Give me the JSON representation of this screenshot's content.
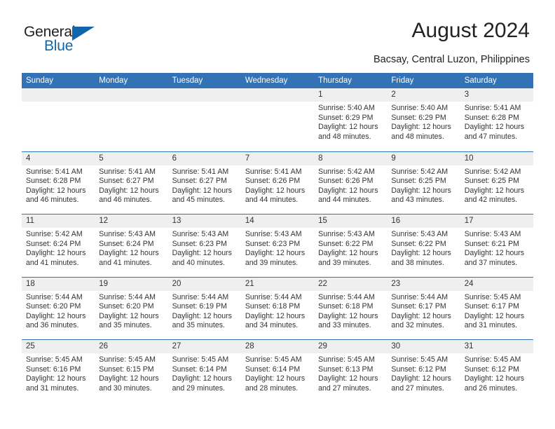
{
  "brand": {
    "name_part1": "General",
    "name_part2": "Blue",
    "accent_color": "#1166ab"
  },
  "header": {
    "title": "August 2024",
    "location": "Bacsay, Central Luzon, Philippines"
  },
  "theme": {
    "header_bg": "#3272b5",
    "daynum_bg": "#efefef",
    "text_color": "#333333"
  },
  "weekday_headers": [
    "Sunday",
    "Monday",
    "Tuesday",
    "Wednesday",
    "Thursday",
    "Friday",
    "Saturday"
  ],
  "weeks": [
    [
      {
        "day": "",
        "sunrise": "",
        "sunset": "",
        "daylight1": "",
        "daylight2": ""
      },
      {
        "day": "",
        "sunrise": "",
        "sunset": "",
        "daylight1": "",
        "daylight2": ""
      },
      {
        "day": "",
        "sunrise": "",
        "sunset": "",
        "daylight1": "",
        "daylight2": ""
      },
      {
        "day": "",
        "sunrise": "",
        "sunset": "",
        "daylight1": "",
        "daylight2": ""
      },
      {
        "day": "1",
        "sunrise": "Sunrise: 5:40 AM",
        "sunset": "Sunset: 6:29 PM",
        "daylight1": "Daylight: 12 hours",
        "daylight2": "and 48 minutes."
      },
      {
        "day": "2",
        "sunrise": "Sunrise: 5:40 AM",
        "sunset": "Sunset: 6:29 PM",
        "daylight1": "Daylight: 12 hours",
        "daylight2": "and 48 minutes."
      },
      {
        "day": "3",
        "sunrise": "Sunrise: 5:41 AM",
        "sunset": "Sunset: 6:28 PM",
        "daylight1": "Daylight: 12 hours",
        "daylight2": "and 47 minutes."
      }
    ],
    [
      {
        "day": "4",
        "sunrise": "Sunrise: 5:41 AM",
        "sunset": "Sunset: 6:28 PM",
        "daylight1": "Daylight: 12 hours",
        "daylight2": "and 46 minutes."
      },
      {
        "day": "5",
        "sunrise": "Sunrise: 5:41 AM",
        "sunset": "Sunset: 6:27 PM",
        "daylight1": "Daylight: 12 hours",
        "daylight2": "and 46 minutes."
      },
      {
        "day": "6",
        "sunrise": "Sunrise: 5:41 AM",
        "sunset": "Sunset: 6:27 PM",
        "daylight1": "Daylight: 12 hours",
        "daylight2": "and 45 minutes."
      },
      {
        "day": "7",
        "sunrise": "Sunrise: 5:41 AM",
        "sunset": "Sunset: 6:26 PM",
        "daylight1": "Daylight: 12 hours",
        "daylight2": "and 44 minutes."
      },
      {
        "day": "8",
        "sunrise": "Sunrise: 5:42 AM",
        "sunset": "Sunset: 6:26 PM",
        "daylight1": "Daylight: 12 hours",
        "daylight2": "and 44 minutes."
      },
      {
        "day": "9",
        "sunrise": "Sunrise: 5:42 AM",
        "sunset": "Sunset: 6:25 PM",
        "daylight1": "Daylight: 12 hours",
        "daylight2": "and 43 minutes."
      },
      {
        "day": "10",
        "sunrise": "Sunrise: 5:42 AM",
        "sunset": "Sunset: 6:25 PM",
        "daylight1": "Daylight: 12 hours",
        "daylight2": "and 42 minutes."
      }
    ],
    [
      {
        "day": "11",
        "sunrise": "Sunrise: 5:42 AM",
        "sunset": "Sunset: 6:24 PM",
        "daylight1": "Daylight: 12 hours",
        "daylight2": "and 41 minutes."
      },
      {
        "day": "12",
        "sunrise": "Sunrise: 5:43 AM",
        "sunset": "Sunset: 6:24 PM",
        "daylight1": "Daylight: 12 hours",
        "daylight2": "and 41 minutes."
      },
      {
        "day": "13",
        "sunrise": "Sunrise: 5:43 AM",
        "sunset": "Sunset: 6:23 PM",
        "daylight1": "Daylight: 12 hours",
        "daylight2": "and 40 minutes."
      },
      {
        "day": "14",
        "sunrise": "Sunrise: 5:43 AM",
        "sunset": "Sunset: 6:23 PM",
        "daylight1": "Daylight: 12 hours",
        "daylight2": "and 39 minutes."
      },
      {
        "day": "15",
        "sunrise": "Sunrise: 5:43 AM",
        "sunset": "Sunset: 6:22 PM",
        "daylight1": "Daylight: 12 hours",
        "daylight2": "and 39 minutes."
      },
      {
        "day": "16",
        "sunrise": "Sunrise: 5:43 AM",
        "sunset": "Sunset: 6:22 PM",
        "daylight1": "Daylight: 12 hours",
        "daylight2": "and 38 minutes."
      },
      {
        "day": "17",
        "sunrise": "Sunrise: 5:43 AM",
        "sunset": "Sunset: 6:21 PM",
        "daylight1": "Daylight: 12 hours",
        "daylight2": "and 37 minutes."
      }
    ],
    [
      {
        "day": "18",
        "sunrise": "Sunrise: 5:44 AM",
        "sunset": "Sunset: 6:20 PM",
        "daylight1": "Daylight: 12 hours",
        "daylight2": "and 36 minutes."
      },
      {
        "day": "19",
        "sunrise": "Sunrise: 5:44 AM",
        "sunset": "Sunset: 6:20 PM",
        "daylight1": "Daylight: 12 hours",
        "daylight2": "and 35 minutes."
      },
      {
        "day": "20",
        "sunrise": "Sunrise: 5:44 AM",
        "sunset": "Sunset: 6:19 PM",
        "daylight1": "Daylight: 12 hours",
        "daylight2": "and 35 minutes."
      },
      {
        "day": "21",
        "sunrise": "Sunrise: 5:44 AM",
        "sunset": "Sunset: 6:18 PM",
        "daylight1": "Daylight: 12 hours",
        "daylight2": "and 34 minutes."
      },
      {
        "day": "22",
        "sunrise": "Sunrise: 5:44 AM",
        "sunset": "Sunset: 6:18 PM",
        "daylight1": "Daylight: 12 hours",
        "daylight2": "and 33 minutes."
      },
      {
        "day": "23",
        "sunrise": "Sunrise: 5:44 AM",
        "sunset": "Sunset: 6:17 PM",
        "daylight1": "Daylight: 12 hours",
        "daylight2": "and 32 minutes."
      },
      {
        "day": "24",
        "sunrise": "Sunrise: 5:45 AM",
        "sunset": "Sunset: 6:17 PM",
        "daylight1": "Daylight: 12 hours",
        "daylight2": "and 31 minutes."
      }
    ],
    [
      {
        "day": "25",
        "sunrise": "Sunrise: 5:45 AM",
        "sunset": "Sunset: 6:16 PM",
        "daylight1": "Daylight: 12 hours",
        "daylight2": "and 31 minutes."
      },
      {
        "day": "26",
        "sunrise": "Sunrise: 5:45 AM",
        "sunset": "Sunset: 6:15 PM",
        "daylight1": "Daylight: 12 hours",
        "daylight2": "and 30 minutes."
      },
      {
        "day": "27",
        "sunrise": "Sunrise: 5:45 AM",
        "sunset": "Sunset: 6:14 PM",
        "daylight1": "Daylight: 12 hours",
        "daylight2": "and 29 minutes."
      },
      {
        "day": "28",
        "sunrise": "Sunrise: 5:45 AM",
        "sunset": "Sunset: 6:14 PM",
        "daylight1": "Daylight: 12 hours",
        "daylight2": "and 28 minutes."
      },
      {
        "day": "29",
        "sunrise": "Sunrise: 5:45 AM",
        "sunset": "Sunset: 6:13 PM",
        "daylight1": "Daylight: 12 hours",
        "daylight2": "and 27 minutes."
      },
      {
        "day": "30",
        "sunrise": "Sunrise: 5:45 AM",
        "sunset": "Sunset: 6:12 PM",
        "daylight1": "Daylight: 12 hours",
        "daylight2": "and 27 minutes."
      },
      {
        "day": "31",
        "sunrise": "Sunrise: 5:45 AM",
        "sunset": "Sunset: 6:12 PM",
        "daylight1": "Daylight: 12 hours",
        "daylight2": "and 26 minutes."
      }
    ]
  ]
}
